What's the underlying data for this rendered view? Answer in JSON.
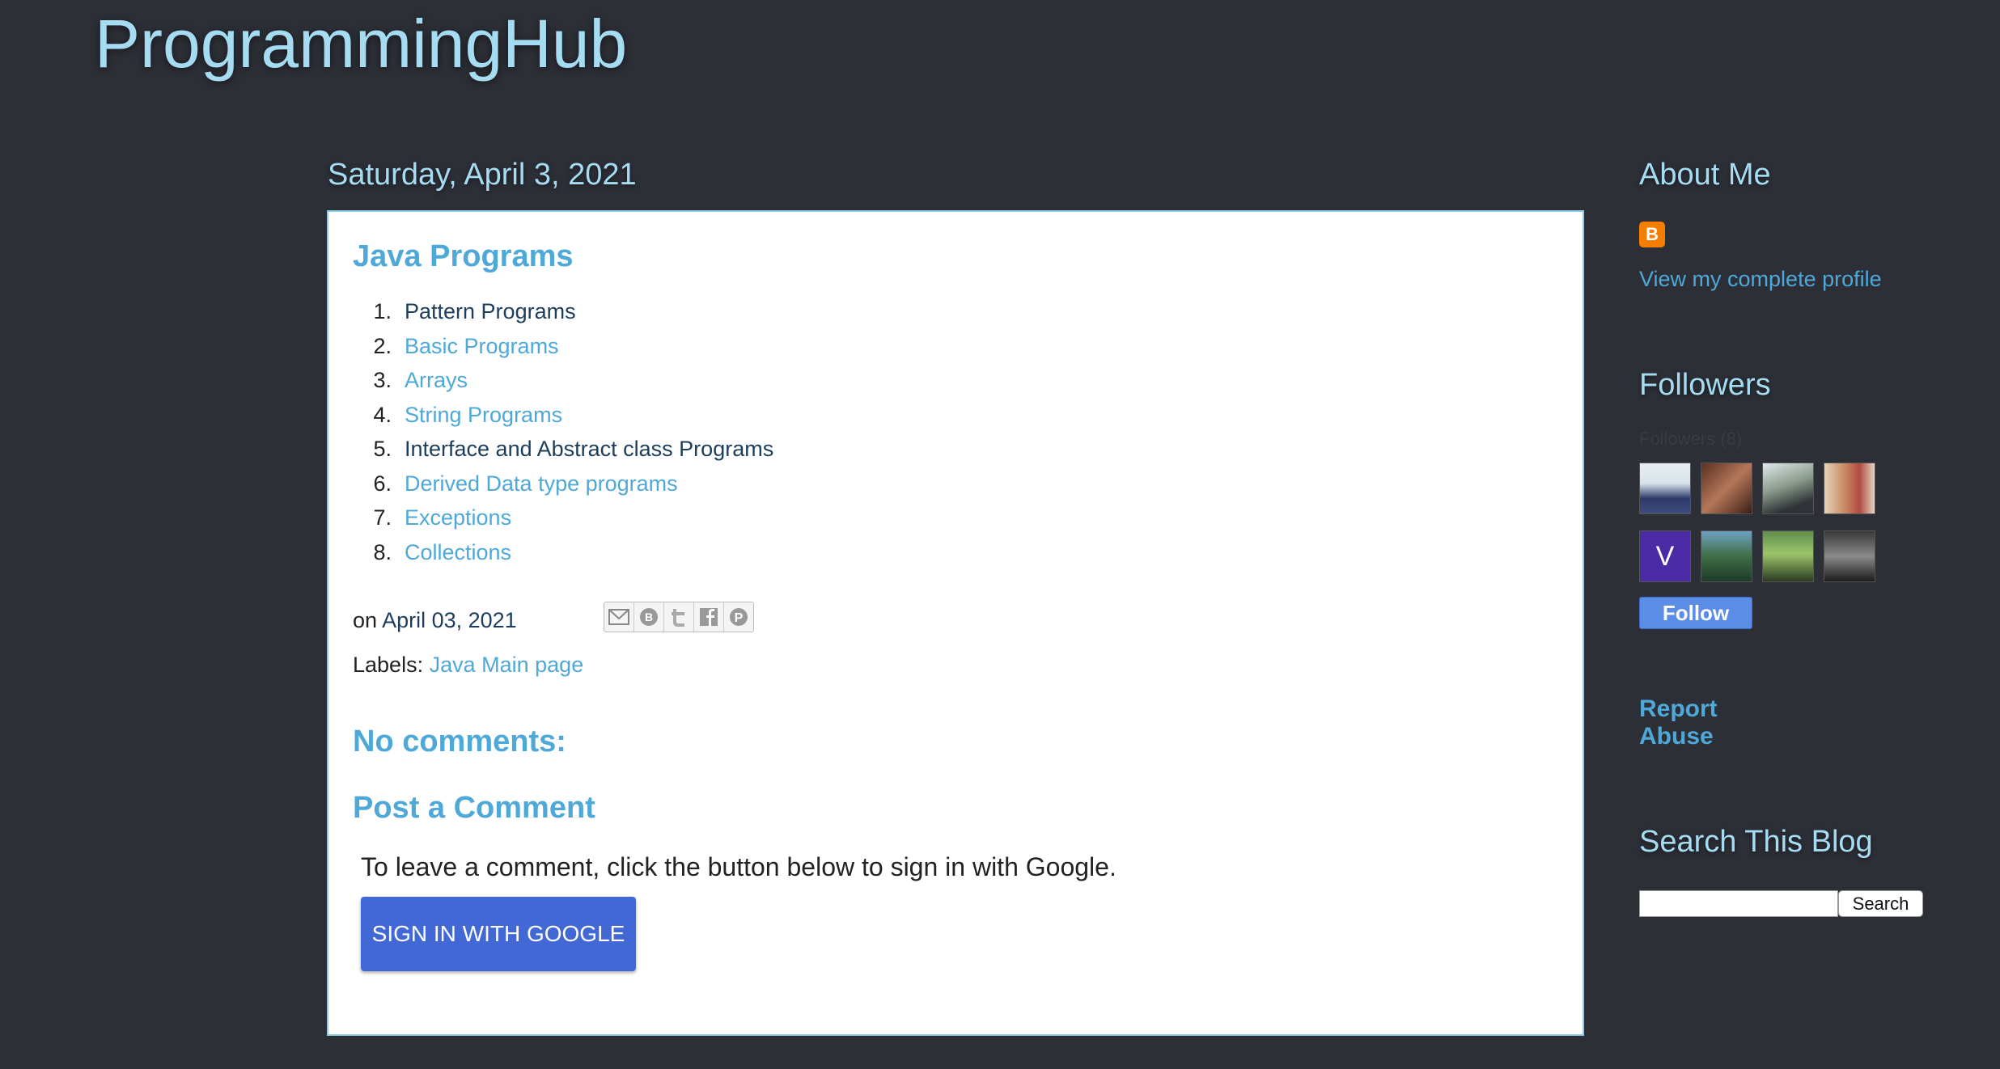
{
  "blog": {
    "title": "ProgrammingHub"
  },
  "post": {
    "date_header": "Saturday, April 3, 2021",
    "title": "Java Programs",
    "items": [
      {
        "num": "1.",
        "label": "Pattern Programs",
        "style": "dark"
      },
      {
        "num": "2.",
        "label": "Basic Programs",
        "style": "light"
      },
      {
        "num": "3.",
        "label": "Arrays",
        "style": "light"
      },
      {
        "num": "4.",
        "label": "String Programs",
        "style": "light"
      },
      {
        "num": "5.",
        "label": "Interface and Abstract class Programs",
        "style": "dark"
      },
      {
        "num": "6.",
        "label": "Derived Data type programs",
        "style": "light"
      },
      {
        "num": "7.",
        "label": "Exceptions",
        "style": "light"
      },
      {
        "num": "8.",
        "label": "Collections",
        "style": "light"
      }
    ],
    "footer_on": "on",
    "footer_date": "April 03, 2021",
    "share_icons": [
      "email-icon",
      "blogger-icon",
      "twitter-icon",
      "facebook-icon",
      "pinterest-icon"
    ],
    "labels_prefix": "Labels:",
    "label_link": "Java Main page"
  },
  "comments": {
    "heading": "No comments:",
    "post_heading": "Post a Comment",
    "note": "To leave a comment, click the button below to sign in with Google.",
    "sign_in_label": "SIGN IN WITH GOOGLE"
  },
  "sidebar": {
    "about_heading": "About Me",
    "profile_link": "View my complete profile",
    "followers_heading": "Followers",
    "followers_by": "Followers (8)",
    "followers": [
      "avatar-1",
      "avatar-2",
      "avatar-3",
      "avatar-4",
      "avatar-v",
      "avatar-6",
      "avatar-7",
      "avatar-8"
    ],
    "avatar_v_letter": "V",
    "follow_label": "Follow",
    "report_abuse": "Report Abuse",
    "search_heading": "Search This Blog",
    "search_button": "Search"
  },
  "colors": {
    "background": "#2d2f37",
    "heading_light": "#a6dcf2",
    "link": "#4ea8d8",
    "link_dark": "#1d3d5c",
    "google_button": "#4268d6",
    "follow_button": "#5b8ce6"
  }
}
